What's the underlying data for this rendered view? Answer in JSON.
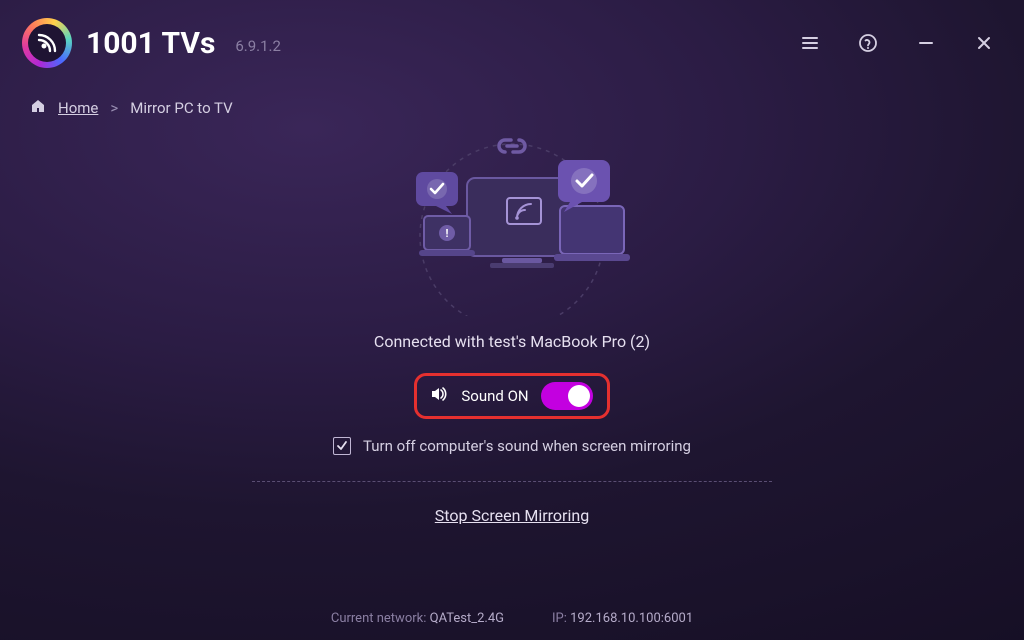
{
  "header": {
    "app_name": "1001 TVs",
    "version": "6.9.1.2"
  },
  "breadcrumb": {
    "home": "Home",
    "current": "Mirror PC to TV"
  },
  "main": {
    "status": "Connected with test's MacBook Pro (2)",
    "sound_label": "Sound ON",
    "sound_on": true,
    "mute_checkbox_label": "Turn off computer's sound when screen mirroring",
    "mute_checked": true,
    "stop_link": "Stop Screen Mirroring"
  },
  "footer": {
    "network_label": "Current network:",
    "network_value": "QATest_2.4G",
    "ip_label": "IP:",
    "ip_value": "192.168.10.100:6001"
  },
  "colors": {
    "accent": "#c300e0",
    "highlight_border": "#e5302f"
  }
}
